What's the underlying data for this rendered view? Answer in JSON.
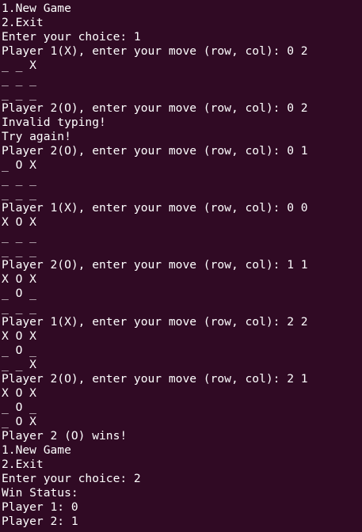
{
  "terminal": {
    "background": "#300a24",
    "foreground": "#ffffff",
    "lines": [
      "1.New Game",
      "2.Exit",
      "Enter your choice: 1",
      "Player 1(X), enter your move (row, col): 0 2",
      "_ _ X",
      "_ _ _",
      "_ _ _",
      "Player 2(O), enter your move (row, col): 0 2",
      "Invalid typing!",
      "Try again!",
      "Player 2(O), enter your move (row, col): 0 1",
      "_ O X",
      "_ _ _",
      "_ _ _",
      "Player 1(X), enter your move (row, col): 0 0",
      "X O X",
      "_ _ _",
      "_ _ _",
      "Player 2(O), enter your move (row, col): 1 1",
      "X O X",
      "_ O _",
      "_ _ _",
      "Player 1(X), enter your move (row, col): 2 2",
      "X O X",
      "_ O _",
      "_ _ X",
      "Player 2(O), enter your move (row, col): 2 1",
      "X O X",
      "_ O _",
      "_ O X",
      "Player 2 (O) wins!",
      "1.New Game",
      "2.Exit",
      "Enter your choice: 2",
      "Win Status:",
      "Player 1: 0",
      "Player 2: 1"
    ]
  }
}
